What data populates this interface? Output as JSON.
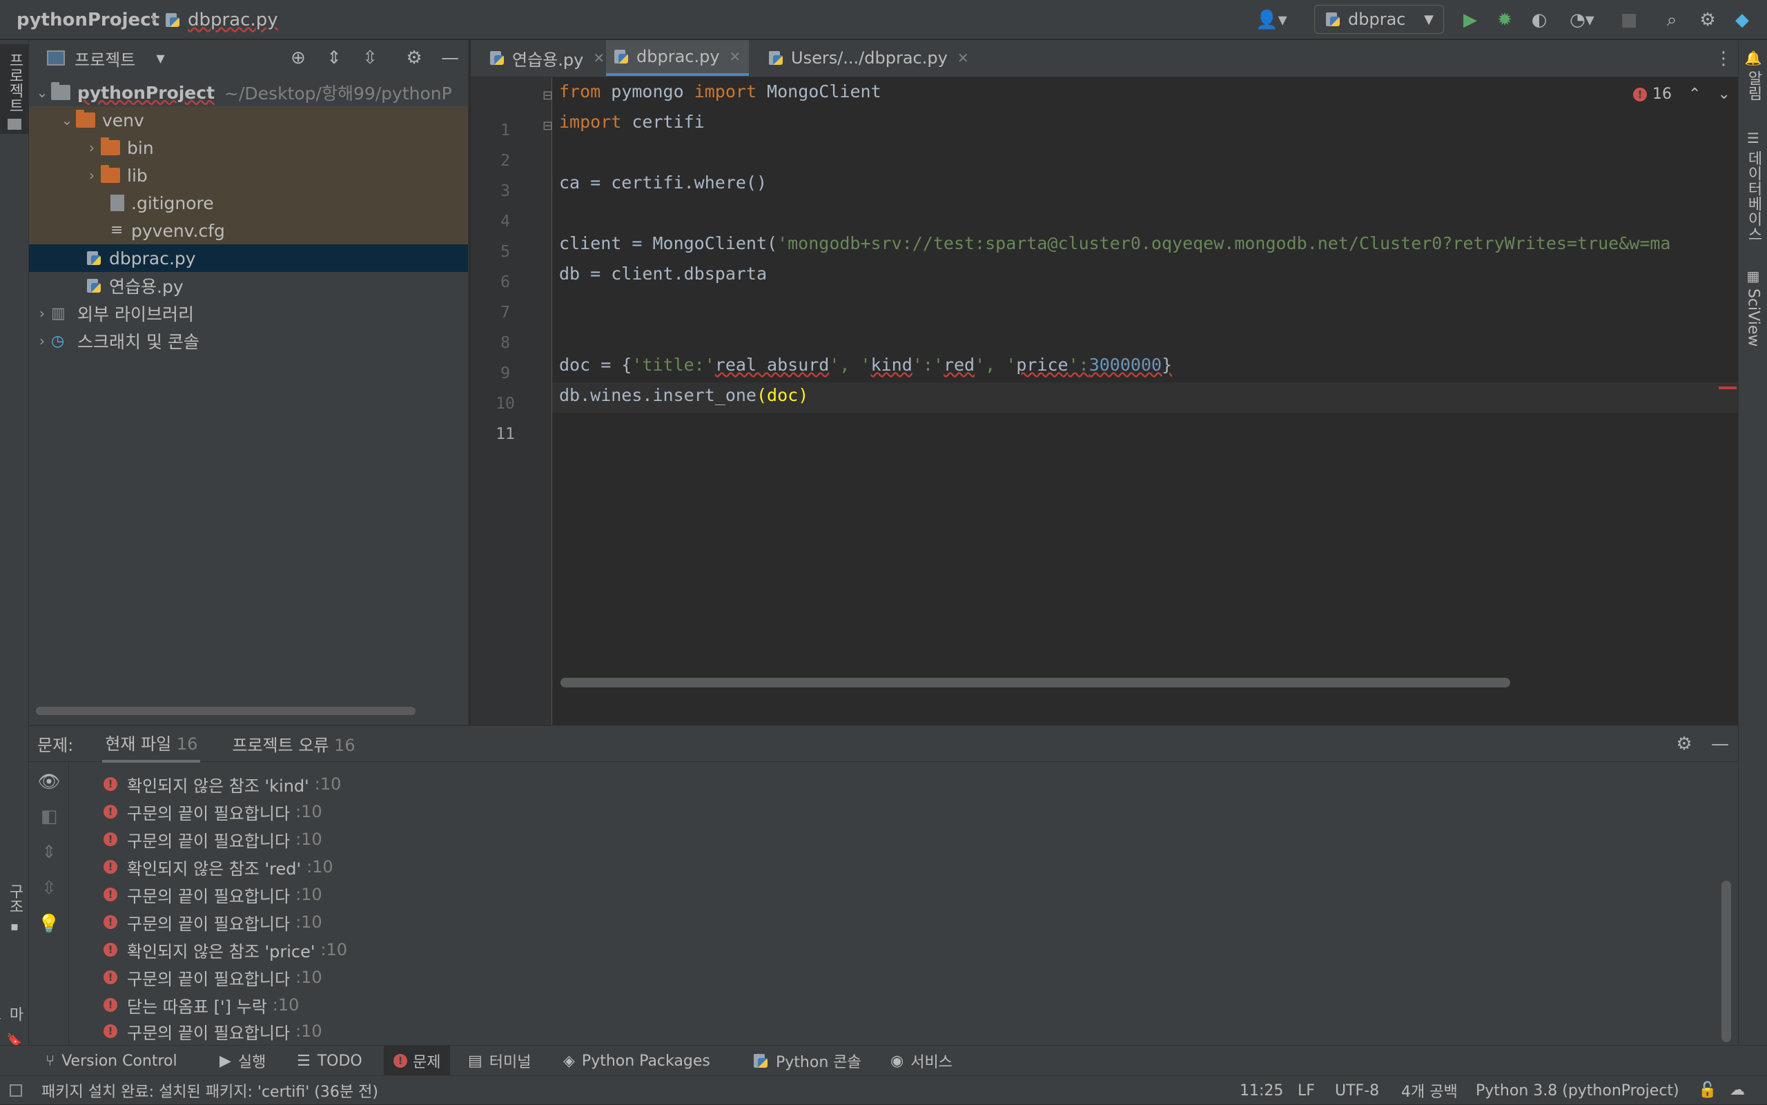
{
  "titlebar": {
    "project": "pythonProject",
    "file": "dbprac.py",
    "run_config": "dbprac"
  },
  "leftstrip": {
    "project_label": "프로젝트",
    "structure_label": "구조",
    "bookmarks_label": "북마크"
  },
  "rightstrip": {
    "notifications_label": "알림",
    "database_label": "데이터베이스",
    "sciview_label": "SciView"
  },
  "project_panel": {
    "title": "프로젝트",
    "tree": [
      {
        "label": "pythonProject",
        "path": "~/Desktop/항해99/pythonP"
      },
      {
        "label": "venv"
      },
      {
        "label": "bin"
      },
      {
        "label": "lib"
      },
      {
        "label": ".gitignore"
      },
      {
        "label": "pyvenv.cfg"
      },
      {
        "label": "dbprac.py"
      },
      {
        "label": "연습용.py"
      },
      {
        "label": "외부 라이브러리"
      },
      {
        "label": "스크래치 및 콘솔"
      }
    ]
  },
  "editor": {
    "tabs": [
      {
        "label": "연습용.py"
      },
      {
        "label": "dbprac.py"
      },
      {
        "label": "Users/.../dbprac.py"
      }
    ],
    "error_count": "16",
    "line_numbers": [
      "1",
      "2",
      "3",
      "4",
      "5",
      "6",
      "7",
      "8",
      "9",
      "10",
      "11"
    ],
    "code": {
      "l1_kw1": "from",
      "l1_mod": " pymongo ",
      "l1_kw2": "import",
      "l1_name": " MongoClient",
      "l2_kw": "import",
      "l2_name": " certifi",
      "l4": "ca = certifi.where()",
      "l6_a": "client = MongoClient(",
      "l6_str": "'mongodb+srv://test:sparta@cluster0.oqyeqew.mongodb.net/Cluster0?retryWrites=true&w=ma",
      "l7": "db = client.dbsparta",
      "l10_a": "doc = {",
      "l10_s1": "'title:'",
      "l10_b": "real absurd",
      "l10_s2": "', '",
      "l10_c": "kind",
      "l10_s3": "':'",
      "l10_d": "red",
      "l10_s4": "', '",
      "l10_e": "price",
      "l10_s5": "':",
      "l10_num": "3000000",
      "l10_end": "}",
      "l11": "db.wines.insert_one",
      "l11_b": "(doc)"
    }
  },
  "problems": {
    "label": "문제:",
    "tab_current": "현재 파일",
    "tab_current_count": "16",
    "tab_project": "프로젝트 오류",
    "tab_project_count": "16",
    "items": [
      {
        "msg": "확인되지 않은 참조 'kind'",
        "loc": ":10"
      },
      {
        "msg": "구문의 끝이 필요합니다",
        "loc": ":10"
      },
      {
        "msg": "구문의 끝이 필요합니다",
        "loc": ":10"
      },
      {
        "msg": "확인되지 않은 참조 'red'",
        "loc": ":10"
      },
      {
        "msg": "구문의 끝이 필요합니다",
        "loc": ":10"
      },
      {
        "msg": "구문의 끝이 필요합니다",
        "loc": ":10"
      },
      {
        "msg": "확인되지 않은 참조 'price'",
        "loc": ":10"
      },
      {
        "msg": "구문의 끝이 필요합니다",
        "loc": ":10"
      },
      {
        "msg": "닫는 따옴표 ['] 누락",
        "loc": ":10"
      },
      {
        "msg": "구문의 끝이 필요합니다",
        "loc": ":10"
      }
    ]
  },
  "toolwindows": [
    {
      "label": "Version Control"
    },
    {
      "label": "실행"
    },
    {
      "label": "TODO"
    },
    {
      "label": "문제"
    },
    {
      "label": "터미널"
    },
    {
      "label": "Python Packages"
    },
    {
      "label": "Python 콘솔"
    },
    {
      "label": "서비스"
    }
  ],
  "statusbar": {
    "message": "패키지 설치 완료: 설치된 패키지: 'certifi' (36분 전)",
    "position": "11:25",
    "line_sep": "LF",
    "encoding": "UTF-8",
    "indent": "4개 공백",
    "interpreter": "Python 3.8 (pythonProject)"
  },
  "colors": {
    "keyword": "#cc7832",
    "string": "#6a8759",
    "number": "#6897bb",
    "error": "#c75450",
    "selection": "#0d293e"
  }
}
